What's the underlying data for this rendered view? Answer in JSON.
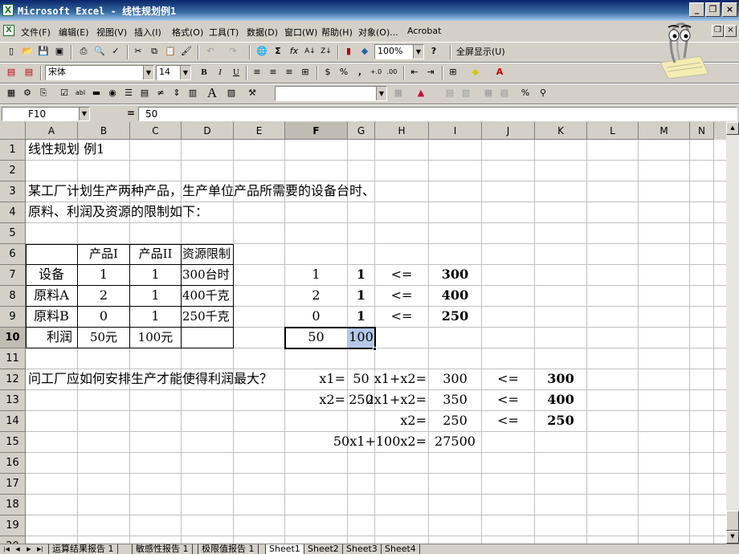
{
  "window": {
    "title": "Microsoft Excel - 线性规划例1",
    "app_icon": "excel-icon"
  },
  "menu": {
    "items": [
      "文件(F)",
      "编辑(E)",
      "视图(V)",
      "插入(I)",
      "格式(O)",
      "工具(T)",
      "数据(D)",
      "窗口(W)",
      "帮助(H)",
      "对象(O)...",
      "Acrobat"
    ]
  },
  "toolbar_standard": {
    "zoom": "100%",
    "fullscreen_label": "全屏显示(U)"
  },
  "toolbar_format": {
    "font": "宋体",
    "size": "14"
  },
  "formula_bar": {
    "name_box": "F10",
    "equals": "=",
    "value": "50"
  },
  "columns": [
    "A",
    "B",
    "C",
    "D",
    "E",
    "F",
    "G",
    "H",
    "I",
    "J",
    "K",
    "L",
    "M",
    "N"
  ],
  "rows": [
    "1",
    "2",
    "3",
    "4",
    "5",
    "6",
    "7",
    "8",
    "9",
    "10",
    "11",
    "12",
    "13",
    "14",
    "15",
    "16",
    "17",
    "18",
    "19",
    "20"
  ],
  "selection": {
    "active_row": "10",
    "active_col": "F"
  },
  "cells": {
    "A1": "线性规划 例1",
    "A3": "某工厂计划生产两种产品，生产单位产品所需要的设备台时、",
    "A4": "原料、利润及资源的限制如下：",
    "B6": "产品I",
    "C6": "产品II",
    "D6": "资源限制",
    "A7": "设备",
    "B7": "1",
    "C7": "1",
    "D7": "300台时",
    "A8": "原料A",
    "B8": "2",
    "C8": "1",
    "D8": "400千克",
    "A9": "原料B",
    "B9": "0",
    "C9": "1",
    "D9": "250千克",
    "A10": "利润",
    "B10": "50元",
    "C10": "100元",
    "F7": "1",
    "G7": "1",
    "H7": "<=",
    "I7": "300",
    "F8": "2",
    "G8": "1",
    "H8": "<=",
    "I8": "400",
    "F9": "0",
    "G9": "1",
    "H9": "<=",
    "I9": "250",
    "F10": "50",
    "G10": "100",
    "A12": "问工厂应如何安排生产才能使得利润最大？",
    "F12": "x1=",
    "G12": "50",
    "H12": "x1+x2=",
    "I12": "300",
    "J12": "<=",
    "K12": "300",
    "F13": "x2=",
    "G13": "250",
    "H13": "2x1+x2=",
    "I13": "350",
    "J13": "<=",
    "K13": "400",
    "H14": "x2=",
    "I14": "250",
    "J14": "<=",
    "K14": "250",
    "H15": "50x1+100x2=",
    "I15": "27500"
  },
  "sheet_tabs": [
    "运算结果报告 1",
    "敏感性报告 1",
    "极限值报告 1",
    "Sheet1",
    "Sheet2",
    "Sheet3",
    "Sheet4"
  ],
  "active_tab": "Sheet1",
  "colors": {
    "title_bar": "#0a246a",
    "chrome": "#d4d0c8",
    "selection": "#b4c8e8"
  }
}
